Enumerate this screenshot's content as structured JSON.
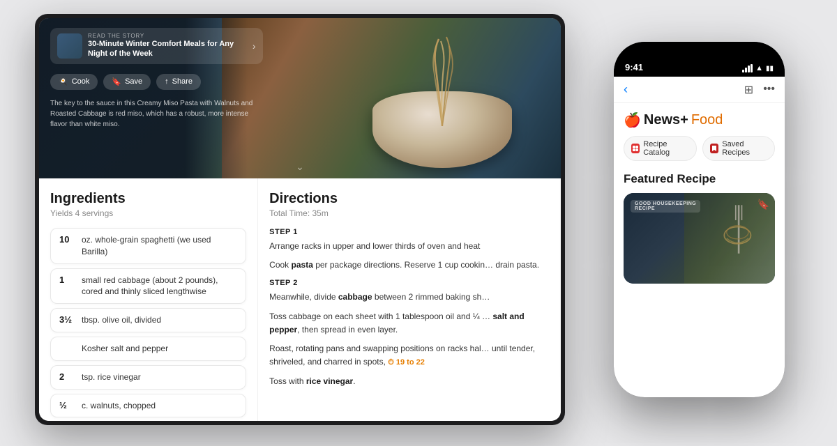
{
  "scene": {
    "bg_color": "#e8e8ea"
  },
  "tablet": {
    "hero": {
      "story_label": "READ THE STORY",
      "story_title": "30-Minute Winter Comfort Meals for Any Night of the Week",
      "cook_btn": "Cook",
      "save_btn": "Save",
      "share_btn": "Share",
      "description": "The key to the sauce in this Creamy Miso Pasta with Walnuts and Roasted Cabbage is red miso, which has a robust, more intense flavor than white miso."
    },
    "ingredients": {
      "title": "Ingredients",
      "subtitle": "Yields 4 servings",
      "items": [
        {
          "amount": "10",
          "description": "oz. whole-grain spaghetti (we used Barilla)"
        },
        {
          "amount": "1",
          "description": "small red cabbage (about 2 pounds), cored and thinly sliced lengthwise"
        },
        {
          "amount": "3½",
          "description": "tbsp. olive oil, divided"
        },
        {
          "amount": "",
          "description": "Kosher salt and pepper"
        },
        {
          "amount": "2",
          "description": "tsp. rice vinegar"
        },
        {
          "amount": "½",
          "description": "c. walnuts, chopped"
        }
      ]
    },
    "directions": {
      "title": "Directions",
      "total_time_label": "Total Time: 35m",
      "steps": [
        {
          "label": "STEP 1",
          "text": "Arrange racks in upper and lower thirds of oven and heat"
        },
        {
          "label": "",
          "text": "Cook pasta per package directions. Reserve 1 cup cookin… drain pasta."
        },
        {
          "label": "STEP 2",
          "text": "Meanwhile, divide cabbage between 2 rimmed baking sh…"
        },
        {
          "label": "",
          "text": "Toss cabbage on each sheet with 1 tablespoon oil and ¼ … salt and pepper, then spread in even layer."
        },
        {
          "label": "",
          "text": "Roast, rotating pans and swapping positions on racks hal… until tender, shriveled, and charred in spots,"
        },
        {
          "label": "",
          "text": "Toss with rice vinegar."
        }
      ],
      "timer_text": "19 to 22"
    }
  },
  "phone": {
    "time": "9:41",
    "nav": {
      "back_icon": "‹",
      "grid_icon": "⊞",
      "more_icon": "•••"
    },
    "brand": {
      "apple_icon": "",
      "news_plus": "News+",
      "food_label": " Food"
    },
    "tabs": [
      {
        "label": "Recipe Catalog",
        "icon_color": "#e03030"
      },
      {
        "label": "Saved Recipes",
        "icon_color": "#e03030"
      }
    ],
    "featured": {
      "title": "Featured Recipe",
      "card": {
        "source_label": "GOOD HOUSEKEEPING",
        "type_label": "RECIPE"
      }
    }
  }
}
